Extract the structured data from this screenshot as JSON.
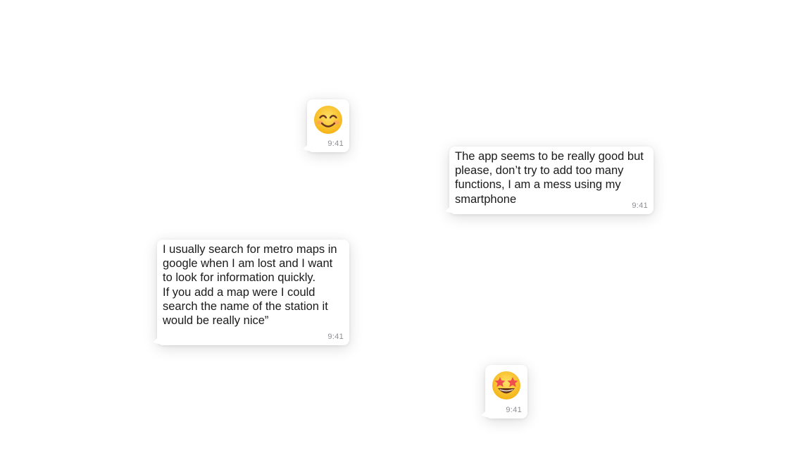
{
  "messages": [
    {
      "id": "smile",
      "emoji": "smiling-face-with-smiling-eyes",
      "time": "9:41"
    },
    {
      "id": "app-feedback",
      "text": "The app seems to be really good but\nplease, don’t try to add too many\nfunctions, I am a mess using my\nsmartphone",
      "time": "9:41"
    },
    {
      "id": "metro-feedback",
      "text": "I usually search for metro maps in\ngoogle when I am lost and I want\nto look for information quickly.\nIf you add a map were I could\nsearch the name of the station it\nwould be really nice”",
      "time": "9:41"
    },
    {
      "id": "star",
      "emoji": "star-struck",
      "time": "9:41"
    }
  ],
  "colors": {
    "bubble": "#ffffff",
    "text": "#1a1a1a",
    "time": "#8e8e93",
    "emoji_face": "#ffc83d",
    "emoji_features": "#6b3a1e",
    "emoji_blush": "#ff8a5c",
    "emoji_star": "#f04e4e"
  }
}
